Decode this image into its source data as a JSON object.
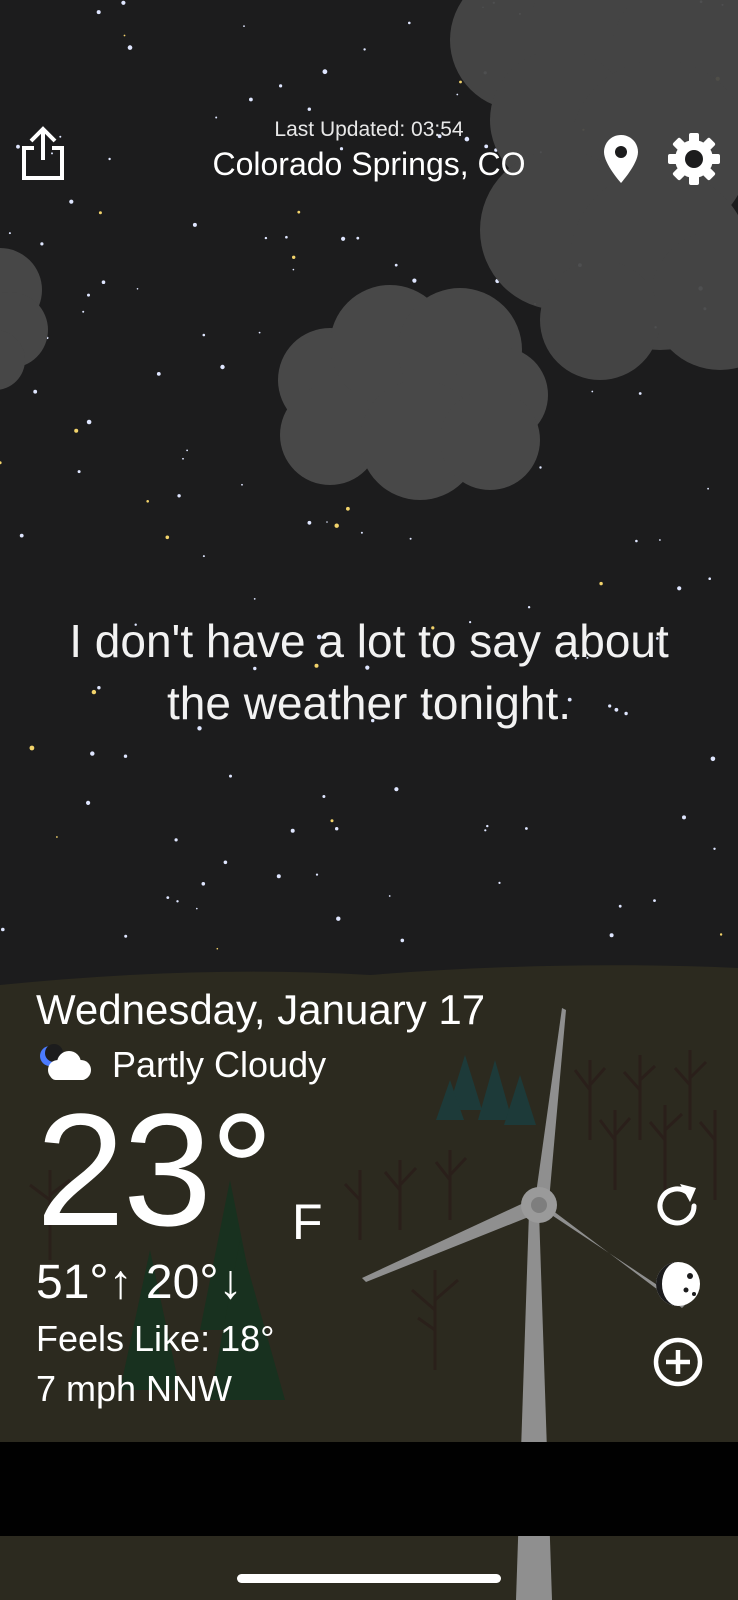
{
  "header": {
    "last_updated": "Last Updated: 03:54",
    "location": "Colorado Springs, CO"
  },
  "message": "I don't have a lot to say about the weather tonight.",
  "forecast": {
    "date": "Wednesday, January 17",
    "condition": "Partly Cloudy",
    "condition_icon": "partly-cloudy-night-icon",
    "temperature": "23°",
    "unit": "F",
    "high_low": "51°↑ 20°↓",
    "feels_like": "Feels Like: 18°",
    "wind": "7 mph NNW"
  },
  "icons": {
    "share": "share-icon",
    "location": "location-pin-icon",
    "settings": "gear-icon",
    "refresh": "refresh-icon",
    "theme": "moon-phase-icon",
    "add": "add-icon"
  },
  "colors": {
    "sky": "#1c1c1d",
    "ground": "#2d2b1f",
    "cloud": "#4a4a4a",
    "text": "#ffffff"
  }
}
